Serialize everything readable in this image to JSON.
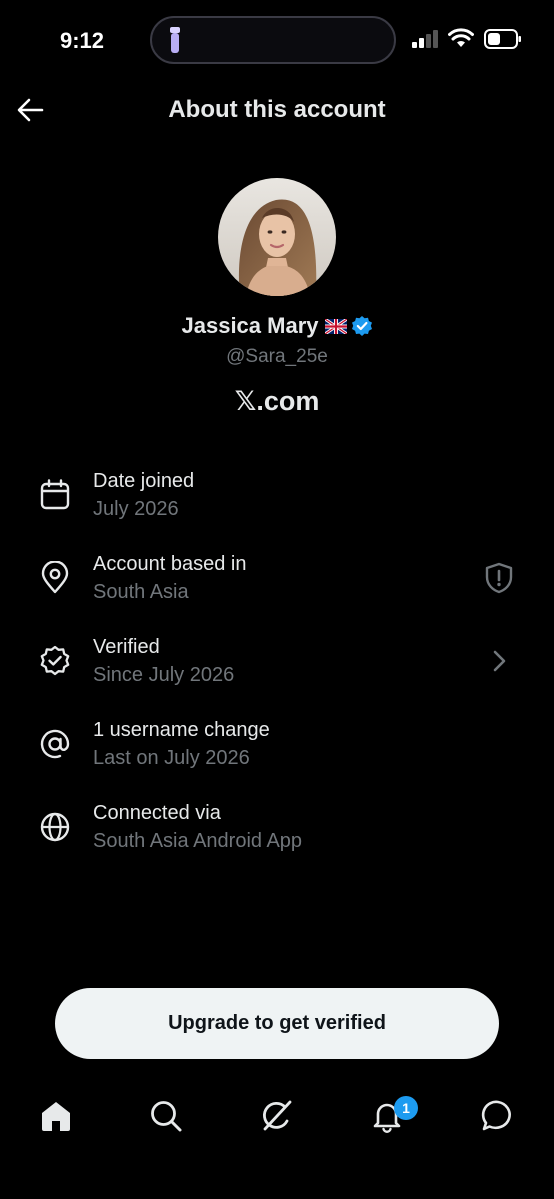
{
  "status_bar": {
    "time": "9:12"
  },
  "header": {
    "title": "About this account"
  },
  "profile": {
    "name": "Jassica Mary",
    "handle": "@Sara_25e",
    "site": "𝕏.com"
  },
  "info": [
    {
      "icon": "calendar-icon",
      "title": "Date joined",
      "subtitle": "July 2026"
    },
    {
      "icon": "location-pin-icon",
      "title": "Account based in",
      "subtitle": "South Asia",
      "right_icon": "shield-alert-icon"
    },
    {
      "icon": "verified-check-icon",
      "title": "Verified",
      "subtitle": "Since July 2026",
      "right_icon": "chevron-right-icon"
    },
    {
      "icon": "at-sign-icon",
      "title": "1 username change",
      "subtitle": "Last on July 2026"
    },
    {
      "icon": "globe-icon",
      "title": "Connected via",
      "subtitle": "South Asia Android App"
    }
  ],
  "cta": {
    "label": "Upgrade to get verified"
  },
  "tabbar": {
    "items": [
      "home-icon",
      "search-icon",
      "grok-icon",
      "notifications-icon",
      "messages-icon"
    ],
    "notification_count": "1"
  },
  "colors": {
    "accent": "#1d9bf0",
    "background": "#000000",
    "secondary_text": "#71767b"
  }
}
